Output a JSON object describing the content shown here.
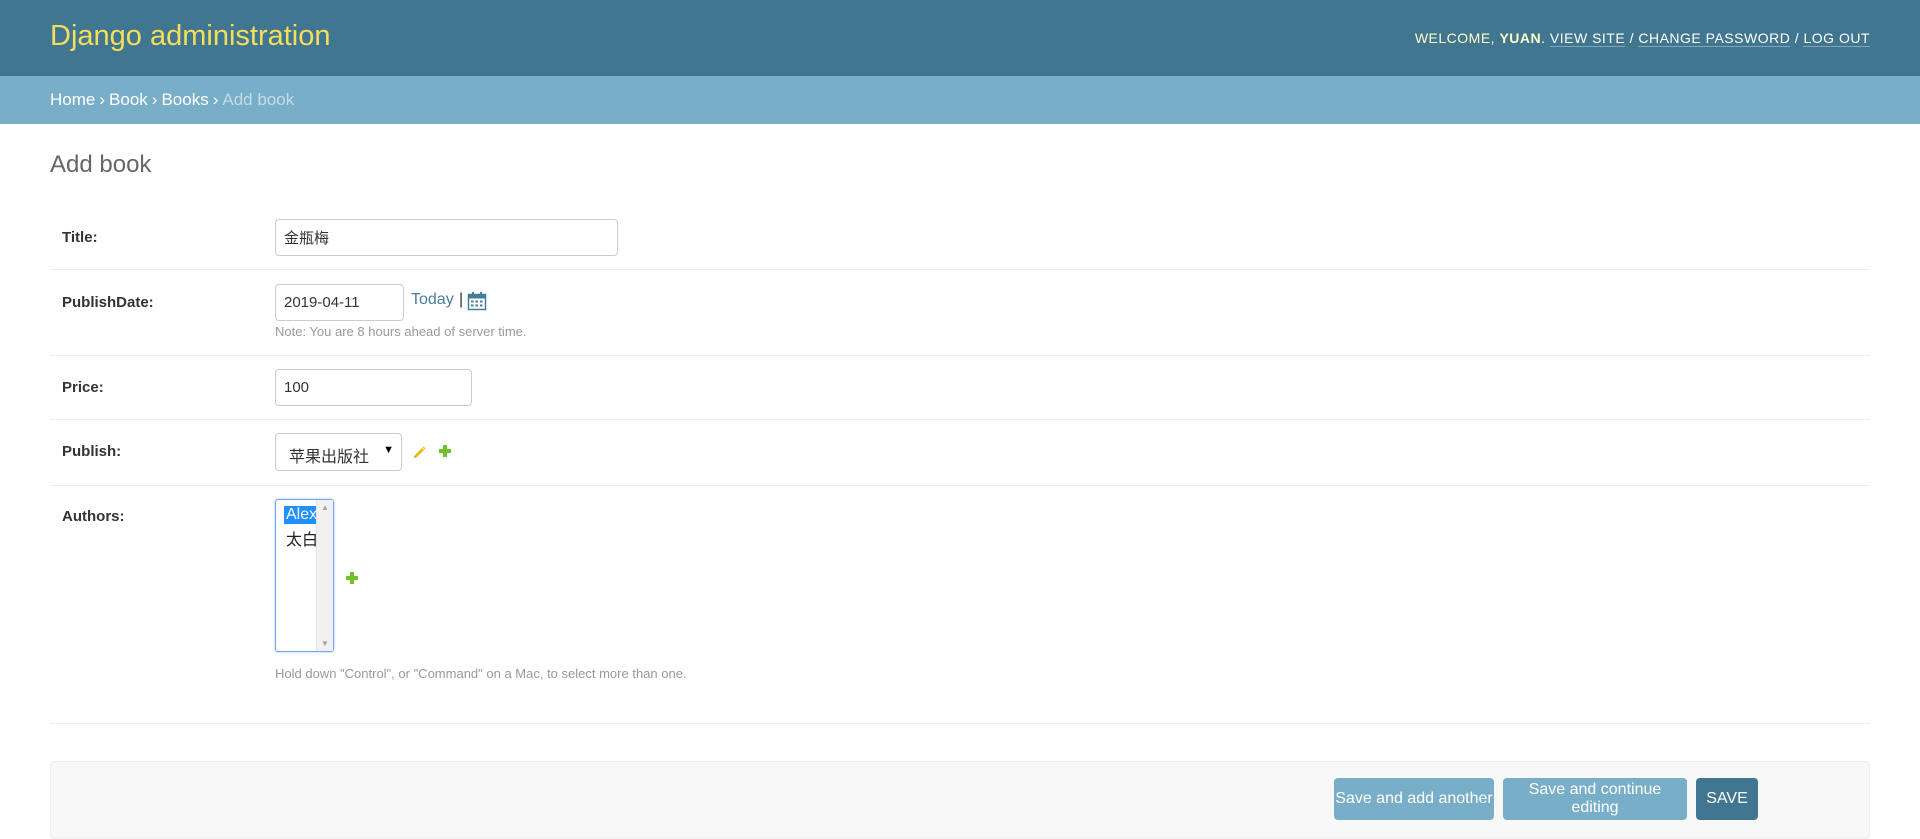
{
  "header": {
    "title": "Django administration",
    "welcome": "WELCOME, ",
    "username": "YUAN",
    "links": [
      "VIEW SITE",
      "CHANGE PASSWORD",
      "LOG OUT"
    ]
  },
  "breadcrumbs": {
    "items": [
      "Home",
      "Book",
      "Books"
    ],
    "current": "Add book"
  },
  "page_title": "Add book",
  "form": {
    "title": {
      "label": "Title:",
      "value": "金瓶梅"
    },
    "publish_date": {
      "label": "PublishDate:",
      "value": "2019-04-11",
      "today_link": "Today",
      "separator": "|",
      "note": "Note: You are 8 hours ahead of server time."
    },
    "price": {
      "label": "Price:",
      "value": "100"
    },
    "publish": {
      "label": "Publish:",
      "selected": "苹果出版社"
    },
    "authors": {
      "label": "Authors:",
      "options": [
        {
          "label": "Alex",
          "selected": true
        },
        {
          "label": "太白",
          "selected": false
        }
      ],
      "help": "Hold down \"Control\", or \"Command\" on a Mac, to select more than one."
    }
  },
  "actions": {
    "save_add_another": "Save and add another",
    "save_continue": "Save and continue editing",
    "save": "SAVE"
  },
  "colors": {
    "header_bg": "#417690",
    "breadcrumb_bg": "#79aec8",
    "branding": "#f5dd5d",
    "link": "#447e9b",
    "add_icon": "#70bf2b",
    "edit_icon": "#efb80b"
  },
  "icons": [
    "calendar-icon",
    "pencil-icon",
    "plus-icon",
    "select-arrow-icon"
  ]
}
